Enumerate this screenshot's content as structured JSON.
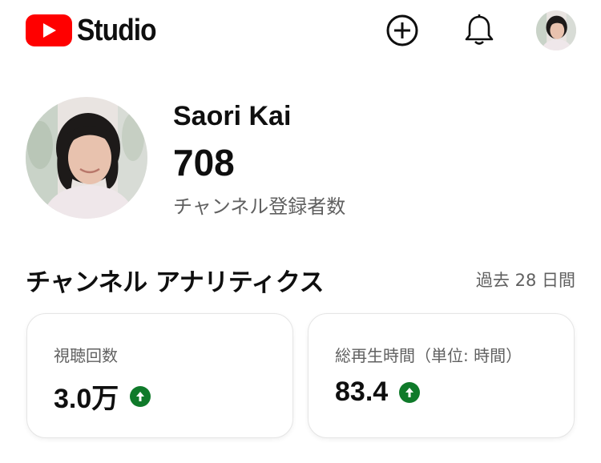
{
  "header": {
    "logo_text": "Studio",
    "icons": {
      "create": "add-circle-icon",
      "notifications": "bell-icon",
      "account": "avatar"
    },
    "brand_color": "#ff0000"
  },
  "channel": {
    "name": "Saori Kai",
    "subscriber_count": "708",
    "subscriber_label": "チャンネル登録者数"
  },
  "analytics": {
    "title": "チャンネル アナリティクス",
    "period": "過去 28 日間",
    "cards": [
      {
        "label": "視聴回数",
        "value": "3.0万",
        "trend": "up",
        "trend_color": "#0f7a2a"
      },
      {
        "label": "総再生時間（単位: 時間）",
        "value": "83.4",
        "trend": "up",
        "trend_color": "#0f7a2a"
      }
    ]
  }
}
